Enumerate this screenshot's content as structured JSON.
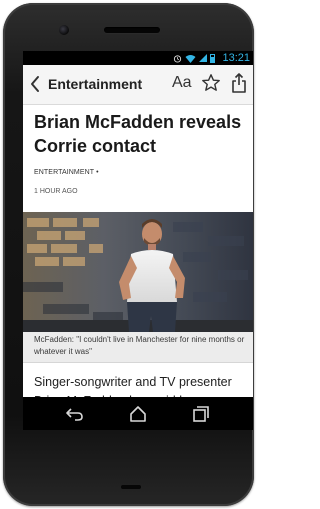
{
  "status_bar": {
    "time": "13:21",
    "icons": [
      "alarm-icon",
      "wifi-icon",
      "signal-icon",
      "battery-icon"
    ]
  },
  "header": {
    "back_icon": "chevron-left-icon",
    "title": "Entertainment",
    "text_size_label": "Aa",
    "bookmark_icon": "star-outline-icon",
    "share_icon": "share-icon"
  },
  "article": {
    "headline": "Brian McFadden reveals Corrie contact",
    "category": "ENTERTAINMENT •",
    "timestamp": "1 HOUR AGO",
    "photo_caption": "McFadden: \"I couldn't live in Manchester for nine months or whatever it was\"",
    "body": "Singer-songwriter and TV presenter Brian McFadden has said he was contacted about joining the cast of"
  },
  "nav_bar": {
    "back_icon": "back-icon",
    "home_icon": "home-icon",
    "recents_icon": "recent-apps-icon"
  },
  "colors": {
    "status_accent": "#33b5e5",
    "header_background": "#f5f5f5",
    "caption_background": "#ececec"
  }
}
